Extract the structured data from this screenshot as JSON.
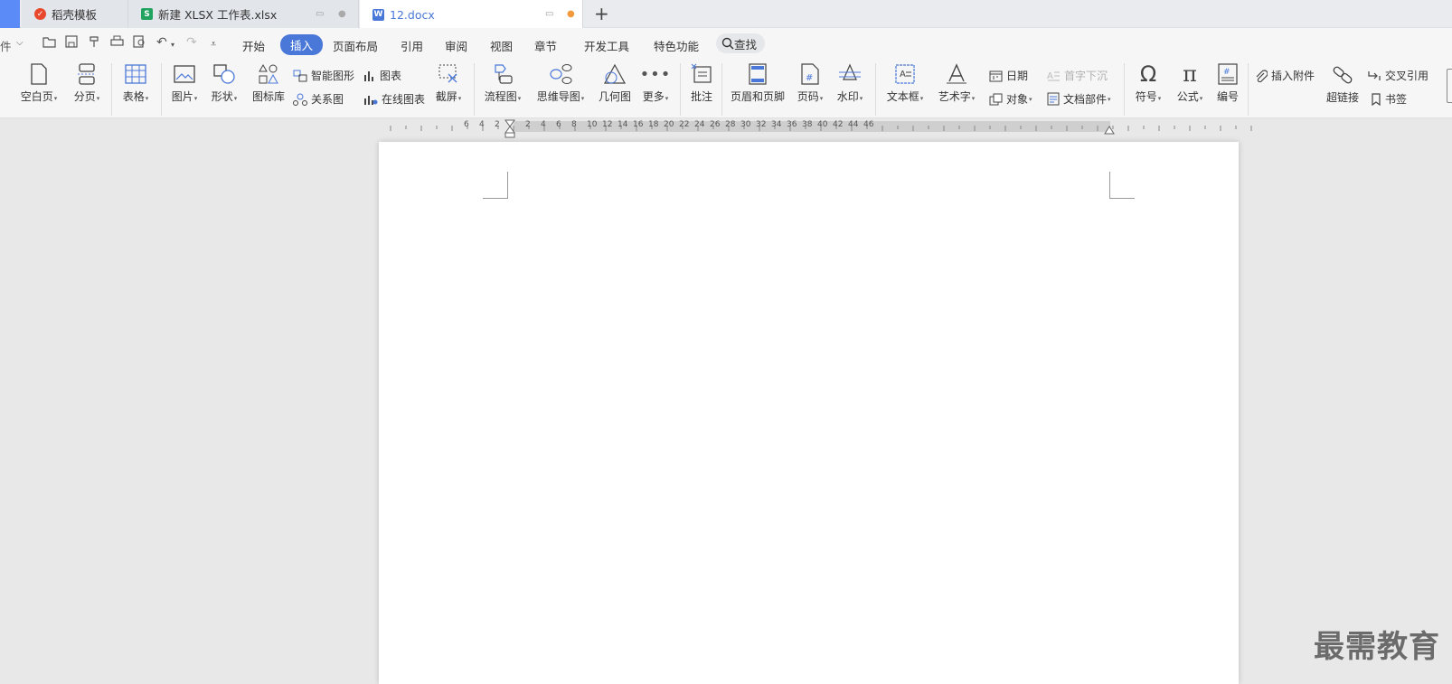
{
  "tabs": [
    {
      "label": "稻壳模板",
      "active": false
    },
    {
      "label": "新建 XLSX 工作表.xlsx",
      "active": false
    },
    {
      "label": "12.docx",
      "active": true
    }
  ],
  "quick_access": {
    "file_label": "件"
  },
  "menu": {
    "items": [
      "开始",
      "插入",
      "页面布局",
      "引用",
      "审阅",
      "视图",
      "章节",
      "开发工具",
      "特色功能"
    ],
    "active": "插入",
    "search_label": "查找"
  },
  "ribbon": {
    "blank_page": "空白页",
    "page_break": "分页",
    "table": "表格",
    "picture": "图片",
    "shape": "形状",
    "icon_library": "图标库",
    "smart_art": "智能图形",
    "chart": "图表",
    "relation_chart": "关系图",
    "online_chart": "在线图表",
    "screenshot": "截屏",
    "flowchart": "流程图",
    "mindmap": "思维导图",
    "geometry": "几何图",
    "more": "更多",
    "comment": "批注",
    "header_footer": "页眉和页脚",
    "page_number": "页码",
    "watermark": "水印",
    "text_box": "文本框",
    "word_art": "艺术字",
    "date": "日期",
    "object": "对象",
    "drop_cap": "首字下沉",
    "doc_parts": "文档部件",
    "symbol": "符号",
    "formula": "公式",
    "numbering": "编号",
    "attachment": "插入附件",
    "hyperlink": "超链接",
    "cross_ref": "交叉引用",
    "bookmark": "书签"
  },
  "ruler": {
    "numbers_left": [
      "6",
      "4",
      "2"
    ],
    "numbers_right": [
      "2",
      "4",
      "6",
      "8",
      "10",
      "12",
      "14",
      "16",
      "18",
      "20",
      "22",
      "24",
      "26",
      "28",
      "30",
      "32",
      "34",
      "36",
      "38",
      "40",
      "42",
      "44",
      "46"
    ]
  },
  "watermark_text": "最需教育",
  "colors": {
    "accent": "#4a78d8",
    "tab_bar": "#e9ebef",
    "canvas": "#e8e8e8"
  }
}
